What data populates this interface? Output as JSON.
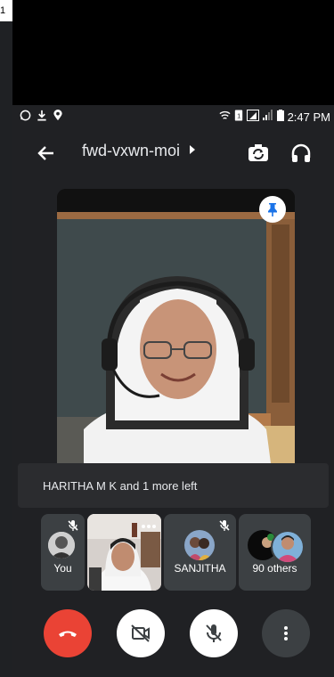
{
  "corner_text": "1",
  "status_bar": {
    "time": "2:47 PM"
  },
  "header": {
    "meeting_code": "fwd-vxwn-moi",
    "back_icon": "arrow-left-icon",
    "switch_camera_icon": "camera-switch-icon",
    "audio_icon": "headphones-icon"
  },
  "main_video": {
    "pin_icon": "pin-icon"
  },
  "notice": {
    "text": "HARITHA M K and 1 more left"
  },
  "participants": [
    {
      "label": "You",
      "muted": true
    },
    {
      "label": "",
      "muted": false
    },
    {
      "label": "SANJITHA",
      "muted": true
    },
    {
      "label": "90 others",
      "muted": false
    }
  ],
  "controls": {
    "end_call_icon": "phone-hangup-icon",
    "camera_icon": "video-off-icon",
    "mic_icon": "mic-off-icon",
    "more_icon": "more-vertical-icon"
  },
  "colors": {
    "end_call": "#ea4335",
    "pin_blue": "#1a73e8",
    "background": "#202124",
    "tile": "#3c4043"
  }
}
